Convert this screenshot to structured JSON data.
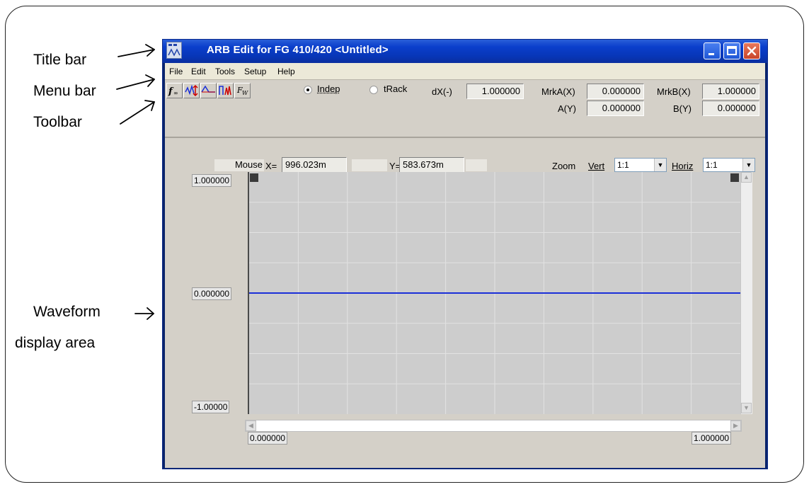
{
  "callouts": {
    "title_bar": "Title bar",
    "menu_bar": "Menu bar",
    "toolbar": "Toolbar",
    "waveform_line1": "Waveform",
    "waveform_line2": "display area"
  },
  "window": {
    "title": "ARB Edit for FG 410/420 <Untitled>",
    "title_bar_color": "#0b3fcc",
    "close_color": "#d4542f"
  },
  "menu": {
    "items": [
      "File",
      "Edit",
      "Tools",
      "Setup",
      "Help"
    ]
  },
  "toolbar": {
    "tool_icons": [
      "function-fx-icon",
      "waveform-edit-icon",
      "triangle-wave-icon",
      "pulse-wave-icon",
      "formula-icon"
    ],
    "radio_indep": "Indep",
    "radio_track": "tRack",
    "dx_label": "dX(-)",
    "dx_value": "1.000000",
    "mrka_label": "MrkA(X)",
    "mrka_value": "0.000000",
    "mrkb_label": "MrkB(X)",
    "mrkb_value": "1.000000",
    "a_label": "A(Y)",
    "a_value": "0.000000",
    "b_label": "B(Y)",
    "b_value": "0.000000"
  },
  "display": {
    "mouse_label": "Mouse",
    "x_label": "X=",
    "x_value": "996.023m",
    "y_label": "Y=",
    "y_value": "583.673m",
    "zoom_label": "Zoom",
    "vert_label": "Vert",
    "vert_value": "1:1",
    "horiz_label": "Horiz",
    "horiz_value": "1:1",
    "y_top": "1.000000",
    "y_mid": "0.000000",
    "y_bottom": "-1.00000",
    "x_left": "0.000000",
    "x_right": "1.000000",
    "waveform_color": "#1a2fd8",
    "waveform_level": 0.0
  }
}
